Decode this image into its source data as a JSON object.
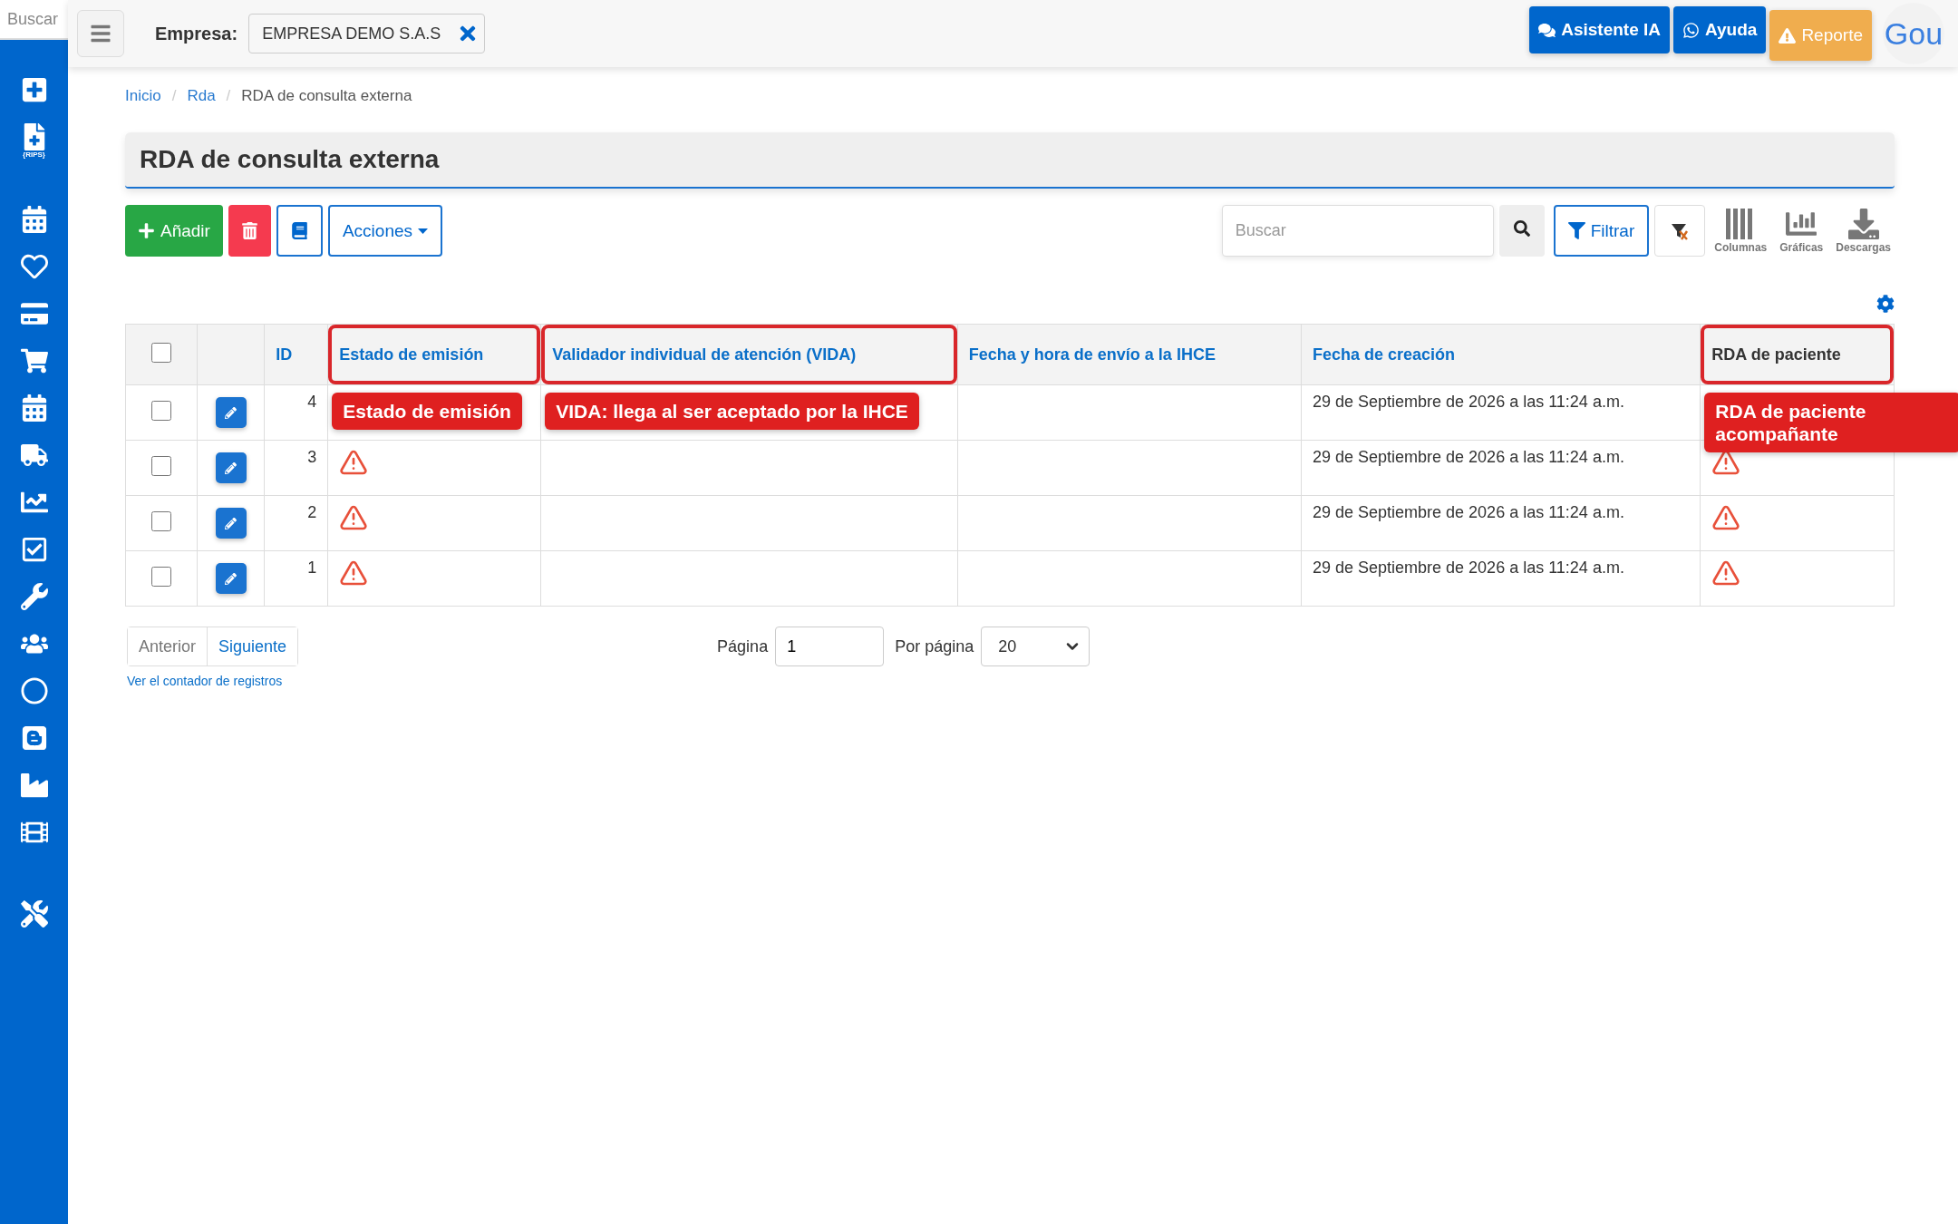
{
  "sidebar": {
    "search": {
      "placeholder": "Buscar"
    },
    "groups": [
      [
        {
          "kind": "plus"
        },
        {
          "kind": "rips",
          "label": "{RIPS}"
        }
      ],
      [
        {
          "kind": "calendar"
        },
        {
          "kind": "heart"
        },
        {
          "kind": "card"
        },
        {
          "kind": "cart"
        },
        {
          "kind": "calendar"
        },
        {
          "kind": "truck"
        },
        {
          "kind": "chart"
        },
        {
          "kind": "check"
        },
        {
          "kind": "wrench"
        },
        {
          "kind": "users"
        },
        {
          "kind": "ring"
        },
        {
          "kind": "blog"
        },
        {
          "kind": "factory"
        },
        {
          "kind": "film"
        }
      ],
      [
        {
          "kind": "tools"
        }
      ]
    ]
  },
  "topbar": {
    "company_label": "Empresa:",
    "company_value": "EMPRESA DEMO S.A.S",
    "buttons": [
      {
        "kind": "chat",
        "label": "Asistente IA"
      },
      {
        "kind": "whatsapp",
        "label": "Ayuda"
      },
      {
        "kind": "report",
        "label": "Reporte"
      }
    ],
    "logo": "Gou"
  },
  "breadcrumb_separator": "/",
  "breadcrumb": [
    {
      "label": "Inicio",
      "link": true
    },
    {
      "label": "Rda",
      "link": true
    },
    {
      "label": "RDA de consulta externa",
      "link": false
    }
  ],
  "title": "RDA de consulta externa",
  "toolbar": {
    "add": "Añadir",
    "actions": "Acciones",
    "search_placeholder": "Buscar",
    "filter": "Filtrar",
    "tools": [
      {
        "kind": "columns",
        "label": "Columnas"
      },
      {
        "kind": "charts",
        "label": "Gráficas"
      },
      {
        "kind": "download",
        "label": "Descargas"
      }
    ]
  },
  "table": {
    "columns": [
      {
        "label": "ID",
        "sortable": true,
        "highlighted": false
      },
      {
        "label": "Estado de emisión",
        "sortable": true,
        "highlighted": true,
        "callout": "Estado de emisión"
      },
      {
        "label": "Validador individual de atención (VIDA)",
        "sortable": true,
        "highlighted": true,
        "callout": "VIDA: llega al ser aceptado por la IHCE"
      },
      {
        "label": "Fecha y hora de envío a la IHCE",
        "sortable": true,
        "highlighted": false
      },
      {
        "label": "Fecha de creación",
        "sortable": true,
        "highlighted": false
      },
      {
        "label": "RDA de paciente",
        "sortable": false,
        "highlighted": true,
        "callout": "RDA de paciente acompañante"
      }
    ],
    "select_all": false,
    "rows": [
      {
        "selected": false,
        "id": "4",
        "created": "29 de Septiembre de 2026 a las 11:24 a.m."
      },
      {
        "selected": false,
        "id": "3",
        "emission_warning": true,
        "created": "29 de Septiembre de 2026 a las 11:24 a.m.",
        "rda_warning": true
      },
      {
        "selected": false,
        "id": "2",
        "emission_warning": true,
        "created": "29 de Septiembre de 2026 a las 11:24 a.m.",
        "rda_warning": true
      },
      {
        "selected": false,
        "id": "1",
        "emission_warning": true,
        "created": "29 de Septiembre de 2026 a las 11:24 a.m.",
        "rda_warning": true
      }
    ]
  },
  "pagination": {
    "prev": "Anterior",
    "next": "Siguiente",
    "counter_link": "Ver el contador de registros",
    "page_label": "Página",
    "page_value": "1",
    "per_page_label": "Por página",
    "per_page_value": "20"
  }
}
